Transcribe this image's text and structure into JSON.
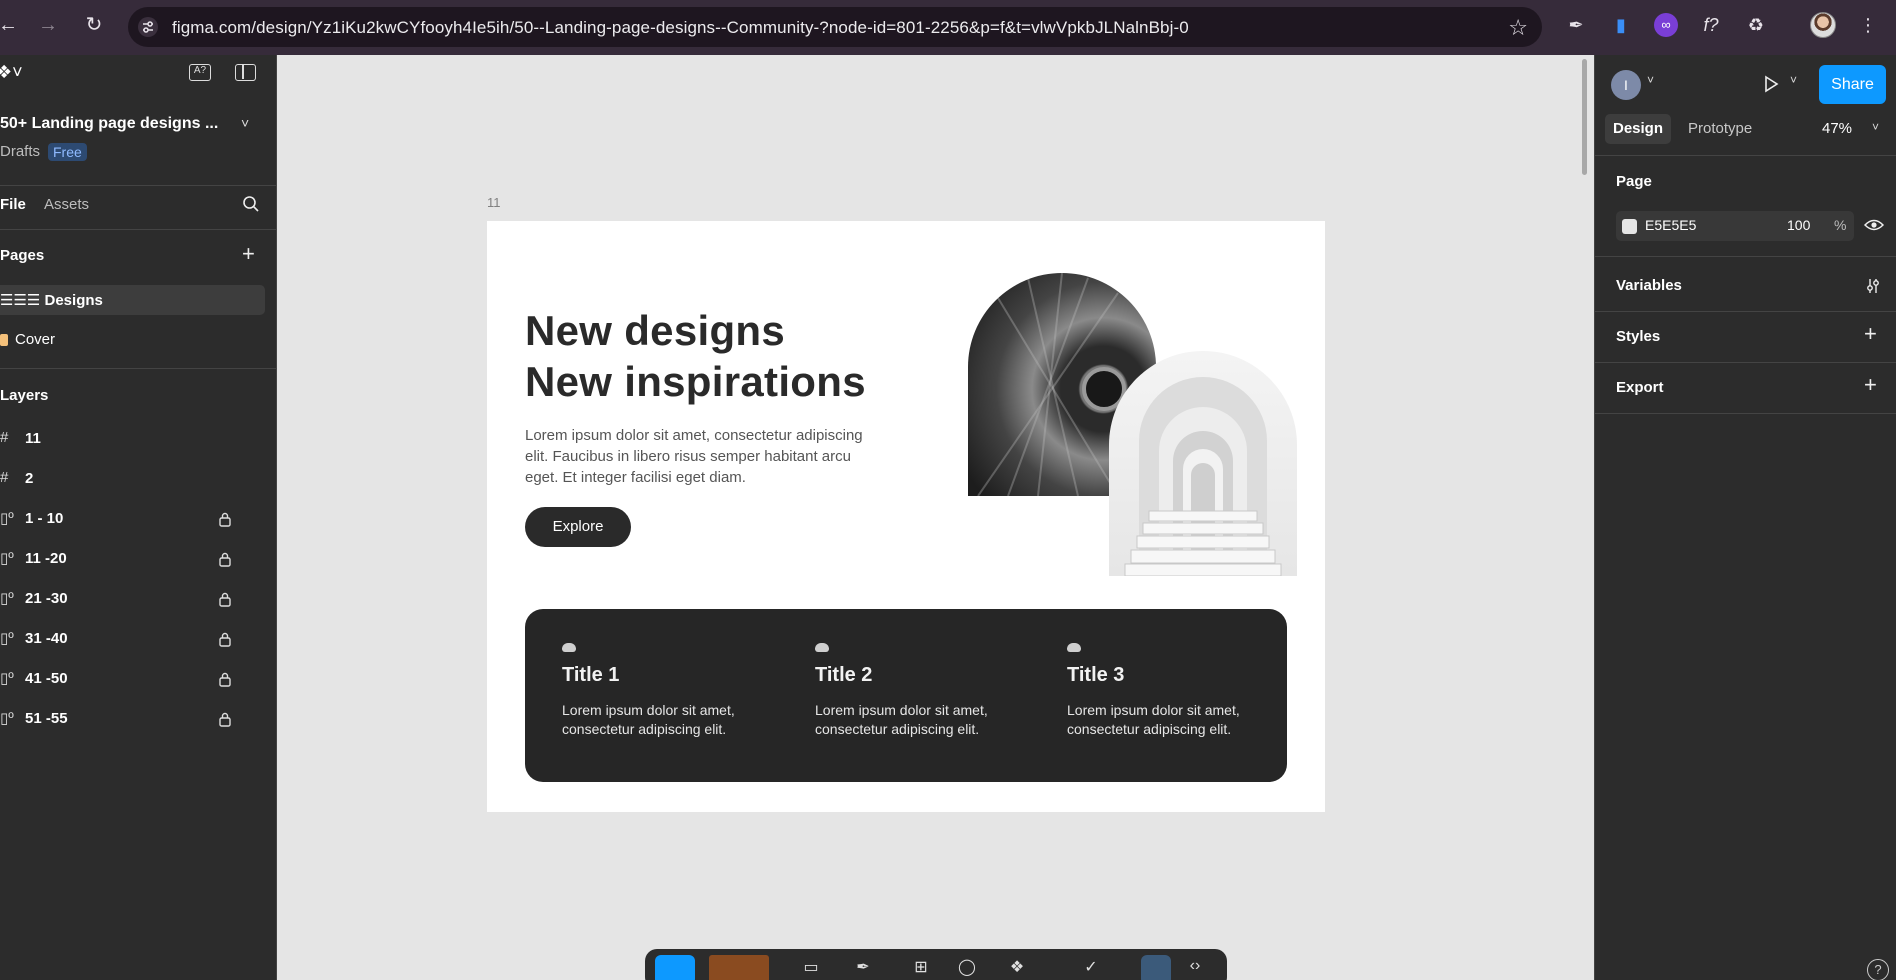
{
  "browser": {
    "url": "figma.com/design/Yz1iKu2kwCYfooyh4Ie5ih/50--Landing-page-designs--Community-?node-id=801-2256&p=f&t=vlwVpkbJLNalnBbj-0"
  },
  "left_panel": {
    "file_title": "50+ Landing page designs ...",
    "location": "Drafts",
    "plan_badge": "Free",
    "tabs": {
      "file": "File",
      "assets": "Assets"
    },
    "pages_heading": "Pages",
    "pages": [
      {
        "label": "☰☰☰ Designs"
      },
      {
        "label": "Cover"
      }
    ],
    "layers_heading": "Layers",
    "layers": [
      {
        "label": "11",
        "icon": "#",
        "locked": false
      },
      {
        "label": "2",
        "icon": "#",
        "locked": false
      },
      {
        "label": "1 - 10",
        "icon": "▯º",
        "locked": true
      },
      {
        "label": "11 -20",
        "icon": "▯º",
        "locked": true
      },
      {
        "label": "21 -30",
        "icon": "▯º",
        "locked": true
      },
      {
        "label": "31 -40",
        "icon": "▯º",
        "locked": true
      },
      {
        "label": "41 -50",
        "icon": "▯º",
        "locked": true
      },
      {
        "label": "51 -55",
        "icon": "▯º",
        "locked": true
      }
    ]
  },
  "canvas": {
    "frame_label": "11",
    "hero": {
      "heading_line1": "New designs",
      "heading_line2": "New inspirations",
      "body": "Lorem ipsum dolor sit amet, consectetur adipiscing elit. Faucibus in libero risus semper habitant arcu eget. Et integer facilisi eget diam.",
      "button": "Explore"
    },
    "features": [
      {
        "title": "Title 1",
        "text": "Lorem ipsum dolor sit amet, consectetur adipiscing elit."
      },
      {
        "title": "Title 2",
        "text": "Lorem ipsum dolor sit amet, consectetur adipiscing elit."
      },
      {
        "title": "Title 3",
        "text": "Lorem ipsum dolor sit amet, consectetur adipiscing elit."
      }
    ]
  },
  "right_panel": {
    "avatar_initial": "I",
    "share_label": "Share",
    "tabs": {
      "design": "Design",
      "prototype": "Prototype"
    },
    "zoom": "47%",
    "page_heading": "Page",
    "page_color": "E5E5E5",
    "page_opacity": "100",
    "opacity_unit": "%",
    "sections": {
      "variables": "Variables",
      "styles": "Styles",
      "export": "Export"
    }
  },
  "colors": {
    "accent": "#0d99ff",
    "canvas_bg": "#e5e5e5",
    "panel_bg": "#2c2c2c"
  }
}
